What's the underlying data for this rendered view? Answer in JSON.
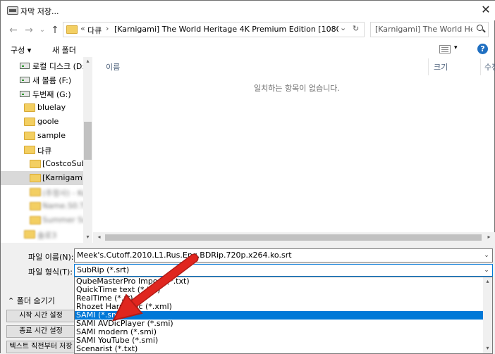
{
  "window": {
    "title": "자막 저장...",
    "close_glyph": "✕"
  },
  "addressbar": {
    "back_glyph": "←",
    "forward_glyph": "→",
    "recent_glyph": "⌄",
    "up_glyph": "↑",
    "overflow": "«",
    "crumbs": [
      "다큐",
      "[Karnigami] The World Heritage 4K Premium Edition [1080..."
    ],
    "crumb_separator": "›",
    "dropdown_glyph": "⌄",
    "refresh_glyph": "↻"
  },
  "search": {
    "placeholder": "[Karnigami] The World Herita..."
  },
  "toolbar": {
    "organize_label": "구성 ▾",
    "new_folder_label": "새 폴더",
    "view_dropdown": "▾",
    "help_label": "?"
  },
  "nav": {
    "items": [
      {
        "label": "로컬 디스크 (D:)",
        "icon": "drive-icon"
      },
      {
        "label": "새 볼륨 (F:)",
        "icon": "drive-icon"
      },
      {
        "label": "두번째 (G:)",
        "icon": "drive-icon"
      },
      {
        "label": "bluelay",
        "icon": "folder-icon"
      },
      {
        "label": "goole",
        "icon": "folder-icon"
      },
      {
        "label": "sample",
        "icon": "folder-icon"
      },
      {
        "label": "다큐",
        "icon": "folder-icon"
      },
      {
        "label": "[CostcoSubs]",
        "icon": "folder-icon"
      },
      {
        "label": "[Karnigami] T",
        "icon": "folder-icon",
        "selected": true
      },
      {
        "label": "(추정사) - Ko",
        "icon": "folder-icon",
        "blurred": true
      },
      {
        "label": "Name.S0.T3",
        "icon": "folder-icon",
        "blurred": true
      },
      {
        "label": "Summer Sub",
        "icon": "folder-icon",
        "blurred": true
      },
      {
        "label": "솔로3",
        "icon": "folder-icon",
        "blurred": true
      }
    ],
    "scroll_up": "▴",
    "scroll_down": "▾"
  },
  "filelist": {
    "columns": [
      "이름",
      "크기",
      "수정"
    ],
    "empty_message": "일치하는 항목이 없습니다.",
    "scroll_left": "◂",
    "scroll_right": "▸"
  },
  "form": {
    "filename_label": "파일 이름(N):",
    "filename_value": "Meek's.Cutoff.2010.L1.Rus.Eng.BDRip.720p.x264.ko.srt",
    "filetype_label": "파일 형식(T):",
    "filetype_value": "SubRip (*.srt)",
    "combo_arrow": "⌄"
  },
  "dropdown": {
    "options": [
      "QubeMasterPro Import (*.txt)",
      "QuickTime text (*.txt)",
      "RealTime (*.rt)",
      "Rhozet Harmonic (*.xml)",
      "SAMI (*.smi)",
      "SAMI AVDicPlayer (*.smi)",
      "SAMI modern (*.smi)",
      "SAMI YouTube (*.smi)",
      "Scenarist (*.txt)"
    ],
    "selected_index": 4,
    "scroll_up": "▴",
    "scroll_down": "▾"
  },
  "sidebar_buttons": {
    "hide_folders": "⌃ 폴더 숨기기",
    "start_time": "시작 시간 설정",
    "end_time": "종료 시간 설정",
    "text_before": "텍스트 직전부터 저장"
  },
  "colors": {
    "selection": "#0078d7",
    "arrow": "#e0261f",
    "folder": "#f3cf62"
  }
}
